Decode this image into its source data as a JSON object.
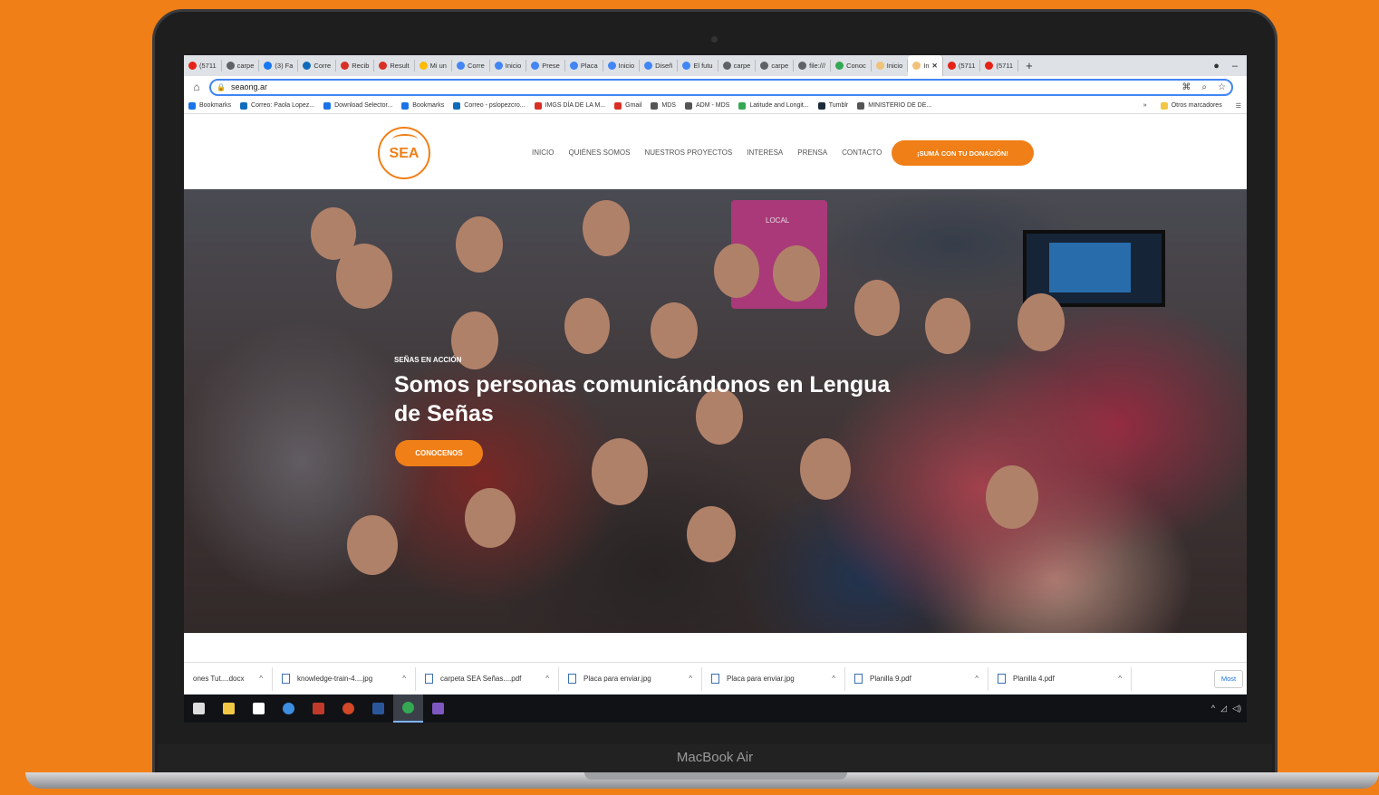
{
  "device": {
    "brand": "MacBook Air"
  },
  "browser": {
    "tabs": [
      {
        "label": "(5711",
        "color": "#e62117"
      },
      {
        "label": "carpe",
        "color": "#5f6368"
      },
      {
        "label": "(3) Fa",
        "color": "#1877f2"
      },
      {
        "label": "Corre",
        "color": "#0f6cbd"
      },
      {
        "label": "Recib",
        "color": "#d93025"
      },
      {
        "label": "Result",
        "color": "#d93025"
      },
      {
        "label": "Mi un",
        "color": "#fbbc04"
      },
      {
        "label": "Corre",
        "color": "#4285f4"
      },
      {
        "label": "Inicio",
        "color": "#4285f4"
      },
      {
        "label": "Prese",
        "color": "#4285f4"
      },
      {
        "label": "Placa",
        "color": "#4285f4"
      },
      {
        "label": "Inicio",
        "color": "#4285f4"
      },
      {
        "label": "Diseñ",
        "color": "#4285f4"
      },
      {
        "label": "El futu",
        "color": "#4285f4"
      },
      {
        "label": "carpe",
        "color": "#5f6368"
      },
      {
        "label": "carpe",
        "color": "#5f6368"
      },
      {
        "label": "file:///",
        "color": "#5f6368"
      },
      {
        "label": "Conoc",
        "color": "#34a853"
      },
      {
        "label": "Inicio",
        "color": "#f0c27a"
      },
      {
        "label": "In",
        "color": "#f0c27a",
        "active": true
      },
      {
        "label": "(5711",
        "color": "#e62117"
      },
      {
        "label": "(5711",
        "color": "#e62117"
      }
    ],
    "new_tab": "+",
    "address": "seaong.ar",
    "bookmarks": [
      {
        "label": "Bookmarks",
        "color": "#1a73e8"
      },
      {
        "label": "Correo: Paola Lopez...",
        "color": "#0f6cbd"
      },
      {
        "label": "Download Selector...",
        "color": "#1a73e8"
      },
      {
        "label": "Bookmarks",
        "color": "#1a73e8"
      },
      {
        "label": "Correo - pslopezcro...",
        "color": "#0f6cbd"
      },
      {
        "label": "IMGS DÍA DE LA M...",
        "color": "#d93025"
      },
      {
        "label": "Gmail",
        "color": "#d93025"
      },
      {
        "label": "MDS",
        "color": "#555555"
      },
      {
        "label": "ADM - MDS",
        "color": "#555555"
      },
      {
        "label": "Latitude and Longit...",
        "color": "#34a853"
      },
      {
        "label": "Tumblr",
        "color": "#1c2b3a"
      },
      {
        "label": "MINISTERIO DE DE...",
        "color": "#555555"
      }
    ],
    "bookmarks_more": "»",
    "other_bookmarks": "Otros marcadores"
  },
  "site": {
    "logo_text": "SEA",
    "nav": [
      "INICIO",
      "QUIÉNES SOMOS",
      "NUESTROS PROYECTOS",
      "INTERESA",
      "PRENSA",
      "CONTACTO"
    ],
    "donate": "¡SUMÁ CON TU DONACIÓN!",
    "hero": {
      "eyebrow": "SEÑAS EN ACCIÓN",
      "headline": "Somos personas comunicándonos en Lengua de Señas",
      "cta": "CONOCENOS",
      "sign_text": "LOCAL"
    },
    "accent_color": "#f07f17"
  },
  "downloads": {
    "items": [
      "ones Tut....docx",
      "knowledge-train-4....jpg",
      "carpeta SEA Señas....pdf",
      "Placa para enviar.jpg",
      "Placa para enviar.jpg",
      "Planilla 9.pdf",
      "Planilla 4.pdf"
    ],
    "more": "Most"
  },
  "taskbar": {
    "apps": [
      {
        "name": "task-view",
        "color": "#dddddd"
      },
      {
        "name": "file-explorer",
        "color": "#f2c744"
      },
      {
        "name": "store",
        "color": "#ffffff"
      },
      {
        "name": "edge",
        "color": "#3d8ee0"
      },
      {
        "name": "shield",
        "color": "#c0392b"
      },
      {
        "name": "powerpoint",
        "color": "#d24726"
      },
      {
        "name": "word",
        "color": "#2b579a"
      },
      {
        "name": "chrome",
        "color": "#34a853"
      },
      {
        "name": "app",
        "color": "#7e57c2"
      }
    ]
  }
}
